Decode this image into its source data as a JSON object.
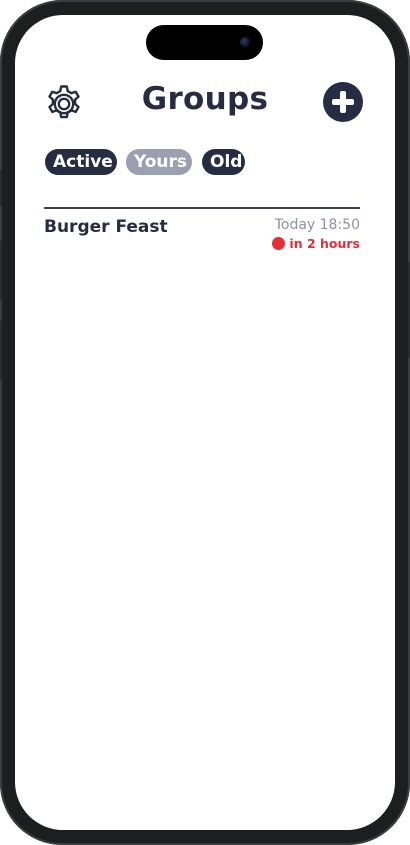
{
  "header": {
    "title": "Groups",
    "settings_icon": "gear-icon",
    "add_icon": "plus-circle-icon"
  },
  "filters": [
    {
      "label": "Active",
      "selected": false
    },
    {
      "label": "Yours",
      "selected": true
    },
    {
      "label": "Old",
      "selected": false
    }
  ],
  "groups": [
    {
      "name": "Burger Feast",
      "time": "Today 18:50",
      "status": "in 2 hours",
      "status_color": "#e62e3a"
    }
  ],
  "colors": {
    "primary": "#262d42",
    "chip_selected": "#9b9fb2",
    "muted_text": "#8c91a6",
    "alert": "#e62e3a"
  }
}
